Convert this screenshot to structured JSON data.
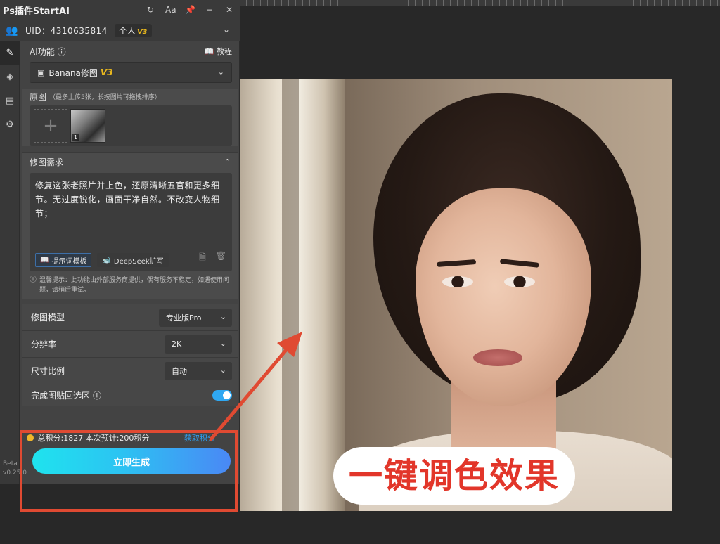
{
  "app": {
    "title": "Ps插件StartAI",
    "toolbar_icons": [
      "refresh-icon",
      "font-size-icon",
      "pin-icon",
      "minimize-icon",
      "close-icon"
    ],
    "font_toggle_label": "Aa"
  },
  "account": {
    "uid_label": "UID：4310635814",
    "tier_label": "个人",
    "tier_version": "V3"
  },
  "sidebar": {
    "items": [
      "edit-icon",
      "layers-icon",
      "clipboard-icon",
      "settings-icon"
    ]
  },
  "ai_function": {
    "label": "AI功能",
    "tutorial_label": "教程",
    "selected": "Banana修图",
    "selected_version": "V3"
  },
  "original": {
    "label": "原图",
    "hint": "（最多上传5张，长按图片可拖拽排序）",
    "thumb_index": "1"
  },
  "requirement": {
    "label": "修图需求",
    "text": "修复这张老照片并上色，还原清晰五官和更多细节。无过度锐化，画面干净自然。不改变人物细节；",
    "template_label": "提示词模板",
    "deepseek_label": "DeepSeek扩写",
    "tip": "温馨提示：此功能由外部服务商提供，偶有服务不稳定，如遇使用问题，请稍后重试。"
  },
  "options": {
    "model_label": "修图模型",
    "model_value": "专业版Pro",
    "resolution_label": "分辨率",
    "resolution_value": "2K",
    "ratio_label": "尺寸比例",
    "ratio_value": "自动",
    "paste_label": "完成图贴回选区",
    "paste_enabled": true
  },
  "footer": {
    "points_text": "总积分:1827  本次预计:200积分",
    "get_points_label": "获取积分",
    "generate_label": "立即生成",
    "beta_label": "Beta",
    "version_label": "v0.25.0"
  },
  "canvas": {
    "caption": "一键调色效果",
    "annotation_color": "#e04a32",
    "caption_color": "#e2362a",
    "accent_color": "#2cc3f2"
  }
}
